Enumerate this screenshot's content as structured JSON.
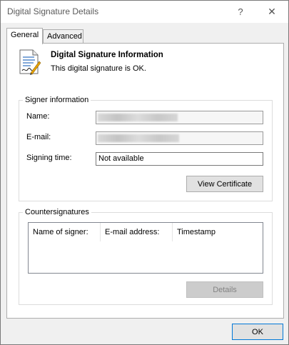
{
  "window": {
    "title": "Digital Signature Details",
    "help_glyph": "?",
    "close_glyph": "✕"
  },
  "tabs": [
    {
      "label": "General",
      "active": true
    },
    {
      "label": "Advanced",
      "active": false
    }
  ],
  "info": {
    "title": "Digital Signature Information",
    "status": "This digital signature is OK."
  },
  "signer": {
    "group_label": "Signer information",
    "name_label": "Name:",
    "email_label": "E-mail:",
    "signing_time_label": "Signing time:",
    "signing_time_value": "Not available",
    "view_certificate": "View Certificate"
  },
  "countersignatures": {
    "group_label": "Countersignatures",
    "columns": [
      "Name of signer:",
      "E-mail address:",
      "Timestamp"
    ],
    "details_button": "Details"
  },
  "footer": {
    "ok_button": "OK"
  },
  "icons": {
    "document": "signed-document-icon"
  },
  "colors": {
    "focus_border": "#0078d7",
    "panel_bg": "#ffffff",
    "window_bg": "#f0f0f0"
  }
}
